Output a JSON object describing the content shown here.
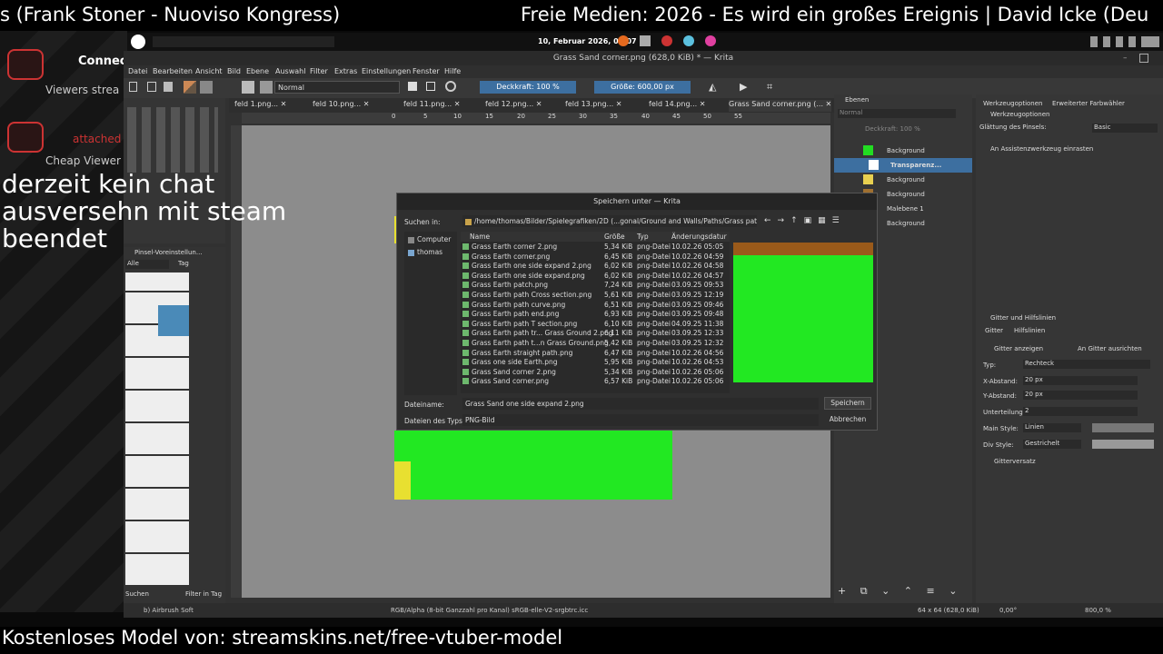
{
  "stream": {
    "top_left": "s (Frank Stoner - Nuoviso Kongress)",
    "top_right": "Freie Medien: 2026 - Es wird ein großes Ereignis | David Icke (Deu",
    "overlay_lines": [
      "derzeit kein chat",
      "ausversehn mit steam",
      "beendet"
    ],
    "bottom": "Kostenloses Model von: streamskins.net/free-vtuber-model",
    "widget_lines": [
      "Connec",
      "Viewers strea",
      "attached",
      "Cheap Viewer"
    ]
  },
  "systray": {
    "datetime": "10, Februar 2026, 05:07"
  },
  "krita": {
    "window_title": "Grass Sand corner.png (628,0 KiB) * — Krita",
    "menu": [
      "Datei",
      "Bearbeiten",
      "Ansicht",
      "Bild",
      "Ebene",
      "Auswahl",
      "Filter",
      "Extras",
      "Einstellungen",
      "Fenster",
      "Hilfe"
    ],
    "blend_mode": "Normal",
    "opacity_label": "Deckkraft: 100 %",
    "size_label": "Größe: 600,00 px",
    "tabs": [
      "feld 1.png...",
      "feld 10.png...",
      "feld 11.png...",
      "feld 12.png...",
      "feld 13.png...",
      "feld 14.png...",
      "Grass Sand corner.png (..."
    ],
    "ruler": [
      "0",
      "5",
      "10",
      "15",
      "20",
      "25",
      "30",
      "35",
      "40",
      "45",
      "50",
      "55"
    ],
    "brush_presets": {
      "title": "Pinsel-Voreinstellun...",
      "filter": "Alle",
      "tag": "Tag",
      "search": "Suchen",
      "filter_in_tag": "Filter in Tag"
    },
    "layers": {
      "title": "Ebenen",
      "blend": "Normal",
      "opacity": "Deckkraft: 100 %",
      "items": [
        {
          "name": "Background",
          "color": "#22dd22"
        },
        {
          "name": "Transparenz...",
          "color": "#ffffff"
        },
        {
          "name": "Background",
          "color": "#e8d050"
        },
        {
          "name": "Background",
          "color": "#a07030"
        },
        {
          "name": "Malebene 1",
          "color": ""
        },
        {
          "name": "Background",
          "color": ""
        }
      ]
    },
    "tool_options": {
      "tab1": "Werkzeugoptionen",
      "tab2": "Erweiterter Farbwähler",
      "header": "Werkzeugoptionen",
      "smoothing_label": "Glättung des Pinsels:",
      "smoothing_value": "Basic",
      "assistant": "An Assistenzwerkzeug einrasten"
    },
    "grid": {
      "title": "Gitter und Hilfslinien",
      "tab1": "Gitter",
      "tab2": "Hilfslinien",
      "show_grid": "Gitter anzeigen",
      "snap_grid": "An Gitter ausrichten",
      "type_label": "Typ:",
      "type_value": "Rechteck",
      "x_label": "X-Abstand:",
      "x_value": "20 px",
      "y_label": "Y-Abstand:",
      "y_value": "20 px",
      "sub_label": "Unterteilung:",
      "sub_value": "2",
      "main_label": "Main Style:",
      "main_value": "Linien",
      "div_label": "Div Style:",
      "div_value": "Gestrichelt",
      "offset": "Gitterversatz"
    },
    "status": {
      "brush": "b) Airbrush Soft",
      "color": "RGB/Alpha (8-bit Ganzzahl pro Kanal)  sRGB-elle-V2-srgbtrc.icc",
      "size": "64 x 64 (628,0 KiB)",
      "rotation": "0,00°",
      "zoom": "800,0 %"
    }
  },
  "dialog": {
    "title": "Speichern unter — Krita",
    "look_in_label": "Suchen in:",
    "path": "/home/thomas/Bilder/Spielegrafiken/2D (...gonal/Ground and Walls/Paths/Grass path",
    "places": [
      "Computer",
      "thomas"
    ],
    "columns": [
      "Name",
      "Größe",
      "Typ",
      "Änderungsdatur"
    ],
    "files": [
      [
        "Grass Earth corner 2.png",
        "5,34 KiB",
        "png-Datei",
        "10.02.26 05:05"
      ],
      [
        "Grass Earth corner.png",
        "6,45 KiB",
        "png-Datei",
        "10.02.26 04:59"
      ],
      [
        "Grass Earth one side expand 2.png",
        "6,02 KiB",
        "png-Datei",
        "10.02.26 04:58"
      ],
      [
        "Grass Earth one side expand.png",
        "6,02 KiB",
        "png-Datei",
        "10.02.26 04:57"
      ],
      [
        "Grass Earth patch.png",
        "7,24 KiB",
        "png-Datei",
        "03.09.25 09:53"
      ],
      [
        "Grass Earth path Cross section.png",
        "5,61 KiB",
        "png-Datei",
        "03.09.25 12:19"
      ],
      [
        "Grass Earth path curve.png",
        "6,51 KiB",
        "png-Datei",
        "03.09.25 09:46"
      ],
      [
        "Grass Earth path end.png",
        "6,93 KiB",
        "png-Datei",
        "03.09.25 09:48"
      ],
      [
        "Grass Earth path T section.png",
        "6,10 KiB",
        "png-Datei",
        "04.09.25 11:38"
      ],
      [
        "Grass Earth path tr... Grass Ground 2.png",
        "6,11 KiB",
        "png-Datei",
        "03.09.25 12:33"
      ],
      [
        "Grass Earth path t...n Grass Ground.png",
        "5,42 KiB",
        "png-Datei",
        "03.09.25 12:32"
      ],
      [
        "Grass Earth straight path.png",
        "6,47 KiB",
        "png-Datei",
        "10.02.26 04:56"
      ],
      [
        "Grass one side Earth.png",
        "5,95 KiB",
        "png-Datei",
        "10.02.26 04:53"
      ],
      [
        "Grass Sand corner 2.png",
        "5,34 KiB",
        "png-Datei",
        "10.02.26 05:06"
      ],
      [
        "Grass Sand corner.png",
        "6,57 KiB",
        "png-Datei",
        "10.02.26 05:06"
      ]
    ],
    "filename_label": "Dateiname:",
    "filename_value": "Grass Sand one side expand 2.png",
    "filetype_label": "Dateien des Typs:",
    "filetype_value": "PNG-Bild",
    "save": "Speichern",
    "cancel": "Abbrechen"
  }
}
